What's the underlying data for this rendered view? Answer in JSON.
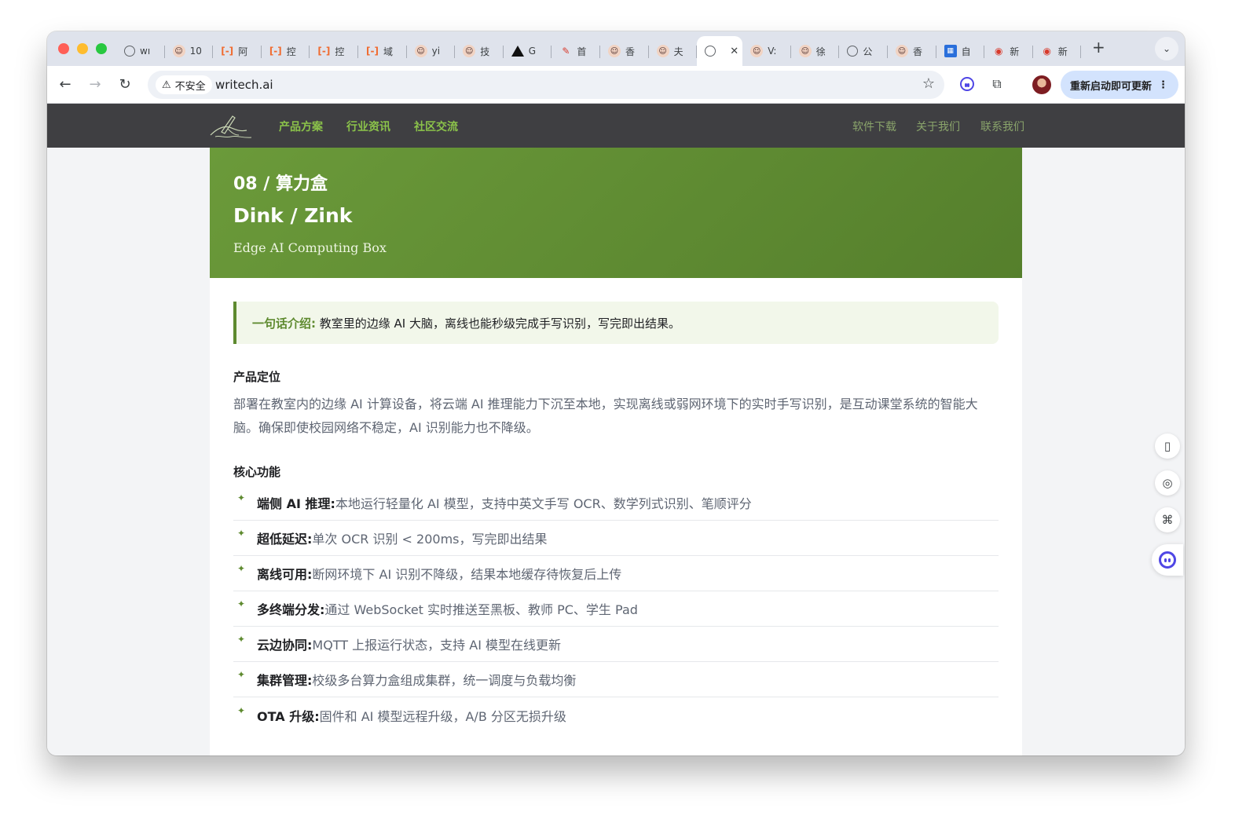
{
  "browser": {
    "tabs": [
      {
        "label": "wı",
        "icon": "globe-icon"
      },
      {
        "label": "10",
        "icon": "avatar-icon"
      },
      {
        "label": "阿",
        "icon": "bracket-icon"
      },
      {
        "label": "控",
        "icon": "bracket-icon"
      },
      {
        "label": "控",
        "icon": "bracket-icon"
      },
      {
        "label": "域",
        "icon": "bracket-icon"
      },
      {
        "label": "yi",
        "icon": "avatar-icon"
      },
      {
        "label": "技",
        "icon": "avatar-icon"
      },
      {
        "label": "G",
        "icon": "triangle-icon"
      },
      {
        "label": "首",
        "icon": "red-logo-icon"
      },
      {
        "label": "香",
        "icon": "avatar-icon"
      },
      {
        "label": "夫",
        "icon": "avatar-icon"
      },
      {
        "label": "",
        "icon": "globe-icon",
        "active": true
      },
      {
        "label": "V:",
        "icon": "avatar-icon"
      },
      {
        "label": "徐",
        "icon": "avatar-icon"
      },
      {
        "label": "公",
        "icon": "globe-icon"
      },
      {
        "label": "香",
        "icon": "avatar-icon"
      },
      {
        "label": "自",
        "icon": "blue-logo-icon"
      },
      {
        "label": "新",
        "icon": "weibo-icon"
      },
      {
        "label": "新",
        "icon": "weibo-icon"
      }
    ],
    "security_label": "不安全",
    "url": "writech.ai",
    "update_label": "重新启动即可更新"
  },
  "site": {
    "nav_left": [
      "产品方案",
      "行业资讯",
      "社区交流"
    ],
    "nav_right": [
      "软件下载",
      "关于我们",
      "联系我们"
    ]
  },
  "product": {
    "kicker": "08 / 算力盒",
    "title": "Dink / Zink",
    "subtitle": "Edge AI Computing Box",
    "intro_label": "一句话介绍:",
    "intro_text": "教室里的边缘 AI 大脑，离线也能秒级完成手写识别，写完即出结果。",
    "positioning_title": "产品定位",
    "positioning_text": "部署在教室内的边缘 AI 计算设备，将云端 AI 推理能力下沉至本地，实现离线或弱网环境下的实时手写识别，是互动课堂系统的智能大脑。确保即使校园网络不稳定，AI 识别能力也不降级。",
    "features_title": "核心功能",
    "features": [
      {
        "k": "端侧 AI 推理:",
        "v": "本地运行轻量化 AI 模型，支持中英文手写 OCR、数学列式识别、笔顺评分"
      },
      {
        "k": "超低延迟:",
        "v": "单次 OCR 识别 < 200ms，写完即出结果"
      },
      {
        "k": "离线可用:",
        "v": "断网环境下 AI 识别不降级，结果本地缓存待恢复后上传"
      },
      {
        "k": "多终端分发:",
        "v": "通过 WebSocket 实时推送至黑板、教师 PC、学生 Pad"
      },
      {
        "k": "云边协同:",
        "v": "MQTT 上报运行状态，支持 AI 模型在线更新"
      },
      {
        "k": "集群管理:",
        "v": "校级多台算力盒组成集群，统一调度与负载均衡"
      },
      {
        "k": "OTA 升级:",
        "v": "固件和 AI 模型远程升级，A/B 分区无损升级"
      }
    ]
  },
  "colors": {
    "hero_green": "#6b9a3a",
    "accent_green": "#5e8a2f",
    "nav_bg": "#3f3f42",
    "nav_link": "#8bc34a"
  }
}
